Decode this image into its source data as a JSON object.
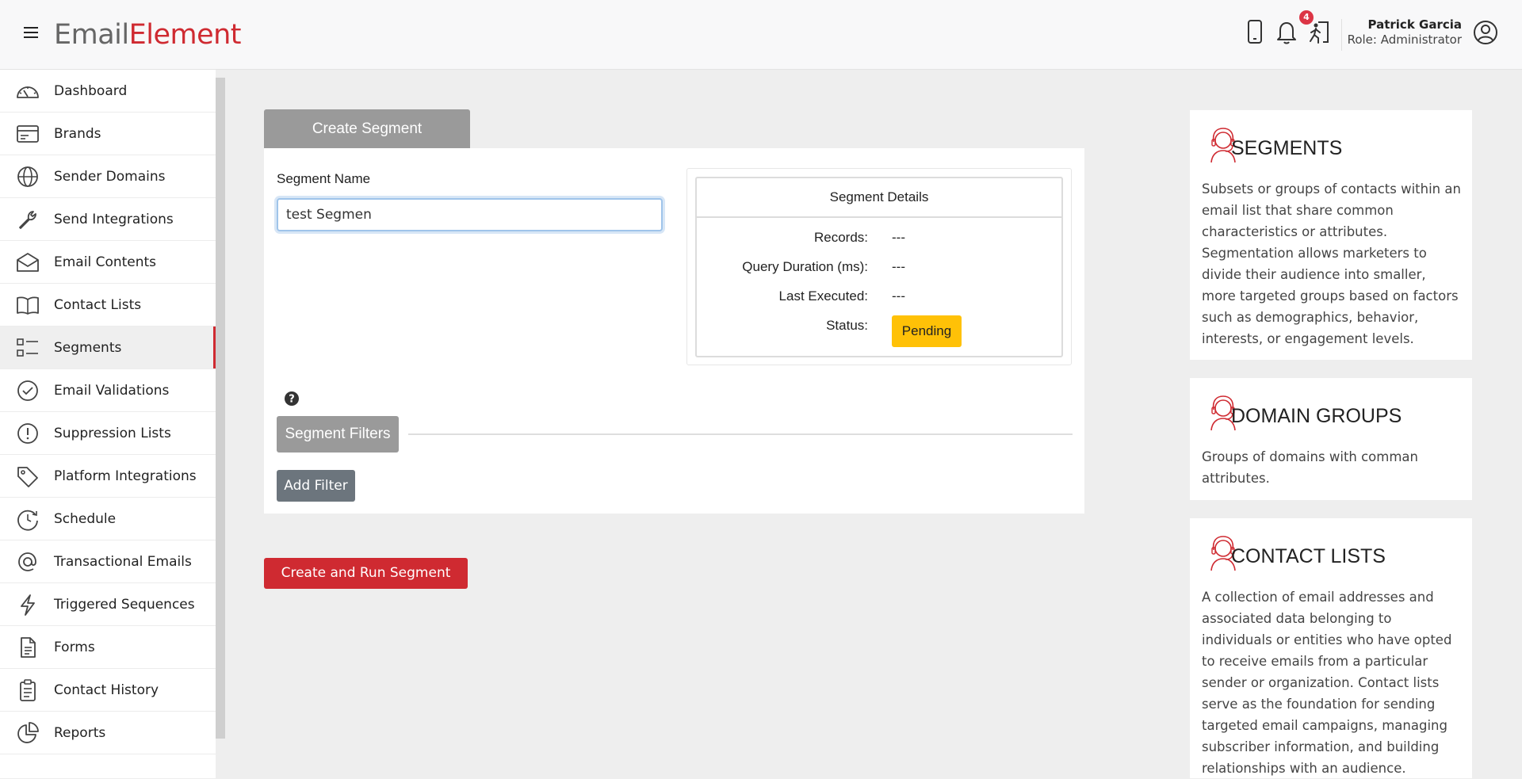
{
  "header": {
    "logo_part1": "Em",
    "logo_part2": "ail",
    "logo_part3": "Element",
    "notification_count": "4",
    "user_name": "Patrick Garcia",
    "user_role": "Role: Administrator",
    "icons": [
      "menu-icon",
      "mobile-icon",
      "bell-icon",
      "exit-icon",
      "user-circle-icon"
    ]
  },
  "sidebar": {
    "items": [
      {
        "label": "Dashboard",
        "icon": "dashboard-icon"
      },
      {
        "label": "Brands",
        "icon": "brands-icon"
      },
      {
        "label": "Sender Domains",
        "icon": "globe-icon"
      },
      {
        "label": "Send Integrations",
        "icon": "wrench-icon"
      },
      {
        "label": "Email Contents",
        "icon": "envelope-icon"
      },
      {
        "label": "Contact Lists",
        "icon": "book-icon"
      },
      {
        "label": "Segments",
        "icon": "segments-icon",
        "active": true
      },
      {
        "label": "Email Validations",
        "icon": "check-circle-icon"
      },
      {
        "label": "Suppression Lists",
        "icon": "exclamation-circle-icon"
      },
      {
        "label": "Platform Integrations",
        "icon": "tag-icon"
      },
      {
        "label": "Schedule",
        "icon": "schedule-icon"
      },
      {
        "label": "Transactional Emails",
        "icon": "at-icon"
      },
      {
        "label": "Triggered Sequences",
        "icon": "lightning-icon"
      },
      {
        "label": "Forms",
        "icon": "document-icon"
      },
      {
        "label": "Contact History",
        "icon": "clipboard-icon"
      },
      {
        "label": "Reports",
        "icon": "pie-chart-icon"
      }
    ]
  },
  "form": {
    "tab_label": "Create Segment",
    "segment_name_label": "Segment Name",
    "segment_name_value": "test Segmen",
    "filters_tab_label": "Segment Filters",
    "add_filter_label": "Add Filter",
    "run_button_label": "Create and Run Segment"
  },
  "details": {
    "title": "Segment Details",
    "records_label": "Records:",
    "records_value": "---",
    "duration_label": "Query Duration (ms):",
    "duration_value": "---",
    "executed_label": "Last Executed:",
    "executed_value": "---",
    "status_label": "Status:",
    "status_value": "Pending"
  },
  "info_cards": [
    {
      "title": "SEGMENTS",
      "body": "Subsets or groups of contacts within an email list that share common characteristics or attributes. Segmentation allows marketers to divide their audience into smaller, more targeted groups based on factors such as demographics, behavior, interests, or engagement levels."
    },
    {
      "title": "DOMAIN GROUPS",
      "body": "Groups of domains with comman attributes."
    },
    {
      "title": "CONTACT LISTS",
      "body": "A collection of email addresses and associated data belonging to individuals or entities who have opted to receive emails from a particular sender or organization. Contact lists serve as the foundation for sending targeted email campaigns, managing subscriber information, and building relationships with an audience."
    }
  ],
  "colors": {
    "accent": "#cf2a31",
    "status_pending": "#ffc107",
    "tab_gray": "#9a9a9a",
    "secondary_button": "#6c757d"
  }
}
